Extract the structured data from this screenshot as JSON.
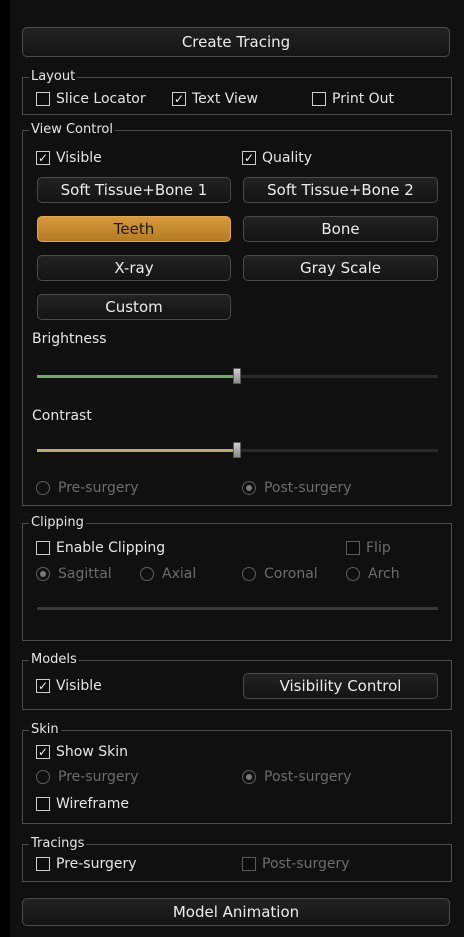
{
  "create_tracing_label": "Create Tracing",
  "layout": {
    "title": "Layout",
    "slice_locator": {
      "label": "Slice Locator",
      "checked": false
    },
    "text_view": {
      "label": "Text View",
      "checked": true
    },
    "print_out": {
      "label": "Print Out",
      "checked": false
    }
  },
  "view_control": {
    "title": "View Control",
    "visible": {
      "label": "Visible",
      "checked": true
    },
    "quality": {
      "label": "Quality",
      "checked": true
    },
    "presets": [
      "Soft Tissue+Bone 1",
      "Soft Tissue+Bone 2",
      "Teeth",
      "Bone",
      "X-ray",
      "Gray Scale",
      "Custom"
    ],
    "selected_preset": "Teeth",
    "brightness_label": "Brightness",
    "brightness_value": 0.5,
    "contrast_label": "Contrast",
    "contrast_value": 0.5,
    "pre_surgery_label": "Pre-surgery",
    "post_surgery_label": "Post-surgery",
    "selected_surgery": "Post-surgery"
  },
  "clipping": {
    "title": "Clipping",
    "enable_label": "Enable Clipping",
    "flip_label": "Flip",
    "planes": [
      "Sagittal",
      "Axial",
      "Coronal",
      "Arch"
    ],
    "selected_plane": "Sagittal"
  },
  "models": {
    "title": "Models",
    "visible_label": "Visible",
    "visible_checked": true,
    "visibility_control_label": "Visibility Control"
  },
  "skin": {
    "title": "Skin",
    "show_skin_label": "Show Skin",
    "show_skin_checked": true,
    "pre_surgery_label": "Pre-surgery",
    "post_surgery_label": "Post-surgery",
    "selected_surgery": "Post-surgery",
    "wireframe_label": "Wireframe",
    "wireframe_checked": false
  },
  "tracings": {
    "title": "Tracings",
    "pre_surgery_label": "Pre-surgery",
    "post_surgery_label": "Post-surgery"
  },
  "model_animation_label": "Model Animation",
  "colors": {
    "accent": "#c88a30",
    "brightness_fill": "#6fa86a",
    "contrast_fill": "#bda878"
  }
}
